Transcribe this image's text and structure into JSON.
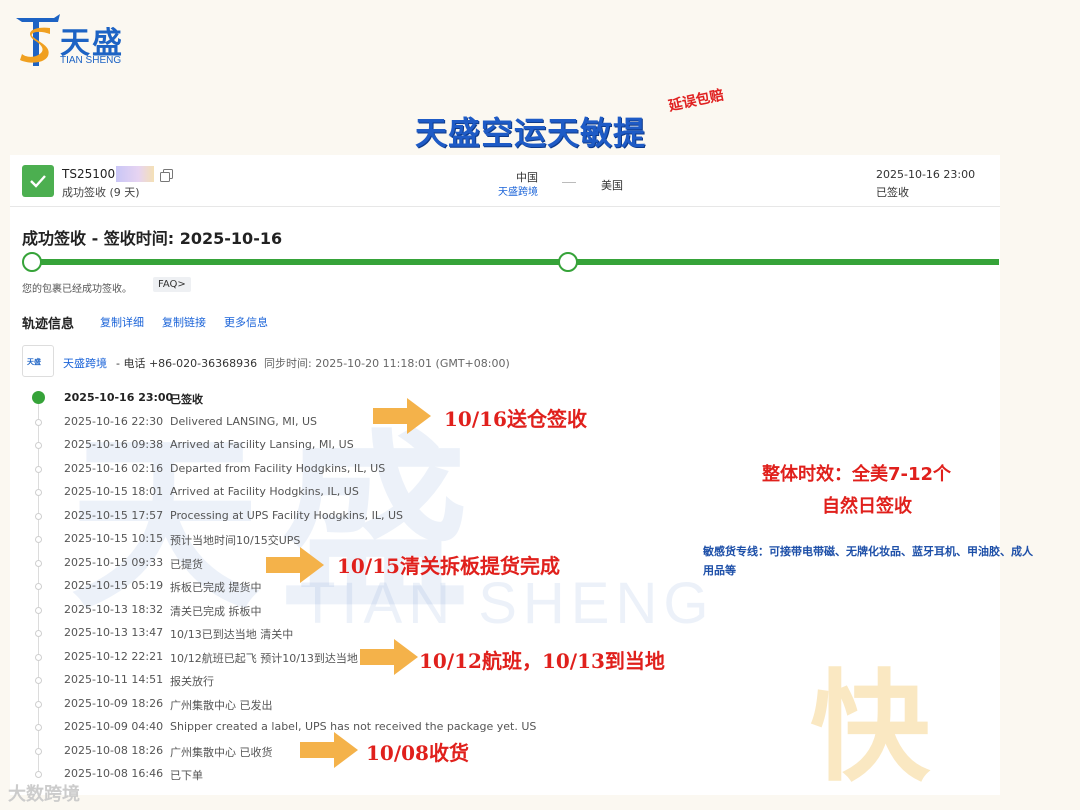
{
  "brand": {
    "name_cn": "天盛",
    "name_en": "TIAN SHENG",
    "primary_color": "#1d63c4",
    "accent_color": "#f0a020"
  },
  "header": {
    "headline": "天盛空运天敏提",
    "stamp": "延误包赔"
  },
  "shipment": {
    "tracking_number": "TS25100",
    "status_summary": "成功签收 (9 天)",
    "origin": "中国",
    "carrier_small": "天盛跨境",
    "destination": "美国",
    "sign_datetime": "2025-10-16 23:00",
    "sign_status": "已签收"
  },
  "delivery": {
    "title": "成功签收 - 签收时间: 2025-10-16",
    "progress_color": "#36a339",
    "note": "您的包裹已经成功签收。",
    "faq_label": "FAQ>"
  },
  "tracking": {
    "heading": "轨迹信息",
    "links": [
      "复制详细",
      "复制链接",
      "更多信息"
    ],
    "carrier_logo_text": "天盛",
    "carrier_name": "天盛跨境",
    "carrier_phone": "- 电话 +86-020-36368936",
    "sync_time": "同步时间: 2025-10-20 11:18:01 (GMT+08:00)",
    "events": [
      {
        "time": "2025-10-16 23:00",
        "desc": "已签收"
      },
      {
        "time": "2025-10-16 22:30",
        "desc": "Delivered LANSING, MI, US"
      },
      {
        "time": "2025-10-16 09:38",
        "desc": "Arrived at Facility Lansing, MI, US"
      },
      {
        "time": "2025-10-16 02:16",
        "desc": "Departed from Facility Hodgkins, IL, US"
      },
      {
        "time": "2025-10-15 18:01",
        "desc": "Arrived at Facility Hodgkins, IL, US"
      },
      {
        "time": "2025-10-15 17:57",
        "desc": "Processing at UPS Facility Hodgkins, IL, US"
      },
      {
        "time": "2025-10-15 10:15",
        "desc": "预计当地时间10/15交UPS"
      },
      {
        "time": "2025-10-15 09:33",
        "desc": "已提货"
      },
      {
        "time": "2025-10-15 05:19",
        "desc": "拆板已完成 提货中"
      },
      {
        "time": "2025-10-13 18:32",
        "desc": "清关已完成 拆板中"
      },
      {
        "time": "2025-10-13 13:47",
        "desc": "10/13已到达当地 清关中"
      },
      {
        "time": "2025-10-12 22:21",
        "desc": "10/12航班已起飞 预计10/13到达当地"
      },
      {
        "time": "2025-10-11 14:51",
        "desc": "报关放行"
      },
      {
        "time": "2025-10-09 18:26",
        "desc": "广州集散中心 已发出"
      },
      {
        "time": "2025-10-09 04:40",
        "desc": "Shipper created a label, UPS has not received the package yet. US"
      },
      {
        "time": "2025-10-08 18:26",
        "desc": "广州集散中心 已收货"
      },
      {
        "time": "2025-10-08 16:46",
        "desc": "已下单"
      }
    ]
  },
  "annotations": {
    "a1": "10/16送仓签收",
    "a2": "10/15清关拆板提货完成",
    "a3": "10/12航班，10/13到当地",
    "a4": "10/08收货",
    "arrow_color": "#f4b24a",
    "text_color": "#e0201c"
  },
  "side": {
    "line1": "整体时效：全美7-12个",
    "line2": "自然日签收",
    "note": "敏感货专线：可接带电带磁、无牌化妆品、蓝牙耳机、甲油胶、成人用品等"
  },
  "watermark": {
    "big": "天盛",
    "en": "TIAN SHENG",
    "fast": "快",
    "bottom": "大数跨境"
  }
}
